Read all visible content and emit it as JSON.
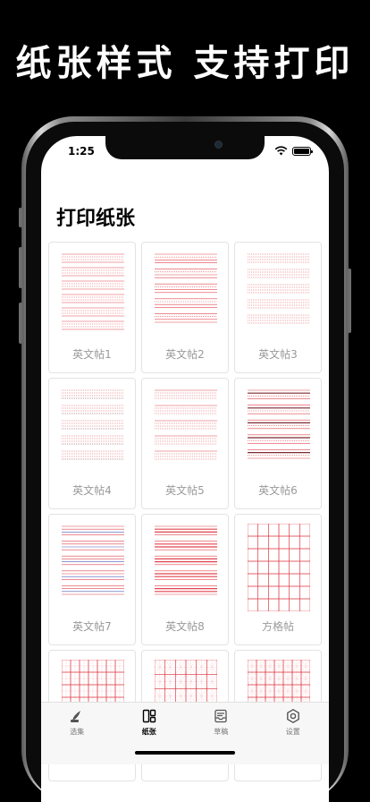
{
  "promo": {
    "title": "纸张样式 支持打印"
  },
  "status_bar": {
    "time": "1:25"
  },
  "page": {
    "title": "打印纸张"
  },
  "colors": {
    "accent_red": "#e0444e",
    "label_gray": "#9a9a9a"
  },
  "papers": [
    {
      "label": "英文帖1",
      "style": "lines-3"
    },
    {
      "label": "英文帖2",
      "style": "lines-4"
    },
    {
      "label": "英文帖3",
      "style": "dotted-4"
    },
    {
      "label": "英文帖4",
      "style": "dotted-dark"
    },
    {
      "label": "英文帖5",
      "style": "dotted-mixed"
    },
    {
      "label": "英文帖6",
      "style": "dark-lines"
    },
    {
      "label": "英文帖7",
      "style": "lines-4-blue"
    },
    {
      "label": "英文帖8",
      "style": "lines-4-bold"
    },
    {
      "label": "方格帖",
      "style": "square-grid"
    },
    {
      "label": "",
      "style": "tian-grid"
    },
    {
      "label": "",
      "style": "mi-grid"
    },
    {
      "label": "",
      "style": "mi-grid-dense"
    }
  ],
  "tab_bar": {
    "items": [
      {
        "label": "选集",
        "icon": "quill-icon",
        "active": false
      },
      {
        "label": "纸张",
        "icon": "layout-icon",
        "active": true
      },
      {
        "label": "草稿",
        "icon": "inbox-icon",
        "active": false
      },
      {
        "label": "设置",
        "icon": "gear-icon",
        "active": false
      }
    ]
  }
}
